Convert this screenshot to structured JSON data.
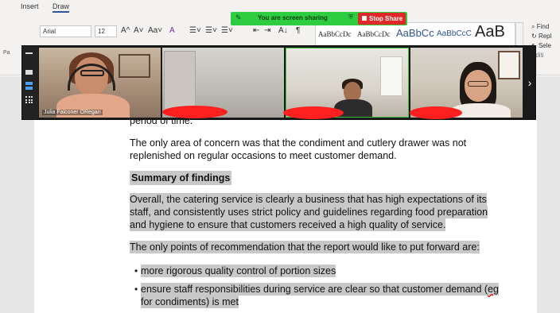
{
  "ribbon": {
    "tabs": [
      "Insert",
      "Draw"
    ],
    "font_name": "Arial",
    "font_size": "12",
    "format_glyphs": [
      "A^",
      "A˅",
      "Aa˅",
      "A"
    ],
    "paragraph_glyphs": [
      "☰˅",
      "☰˅",
      "☰˅",
      "⇤",
      "⇥",
      "A↓",
      "¶"
    ],
    "styles": {
      "normal": "AaBbCcDc",
      "no_spacing": "AaBbCcDc",
      "heading1": "AaBbCc",
      "heading2": "AaBbCcC",
      "title": "AaB"
    },
    "editing": {
      "find": "Find",
      "replace": "Repl",
      "select": "Sele",
      "group": "Editi"
    },
    "side_label": "Pa"
  },
  "share_banner": {
    "message": "You are screen sharing",
    "stop_label": "Stop Share",
    "color": "#2ecc40",
    "stop_color": "#e02828"
  },
  "video_strip": {
    "participant1_name": "Julia Falconer ORegan"
  },
  "document": {
    "lines": [
      "period of time.",
      "The only area of concern was that the condiment and cutlery drawer was not",
      "replenished on regular occasions to meet customer demand.",
      "Summary of findings",
      "Overall, the catering service is clearly a business that has high expectations of its",
      "staff, and consistently uses strict policy and guidelines regarding food preparation",
      "and hygiene to ensure that customers received a high quality of service.",
      "The only points of recommendation that the report would like to put forward are:"
    ],
    "bullets": [
      "more rigorous quality control of portion sizes",
      "ensure staff responsibilities during service are clear so that customer demand (",
      "eg",
      "for condiments) is met"
    ],
    "highlight_color": "#c8c8c8"
  }
}
